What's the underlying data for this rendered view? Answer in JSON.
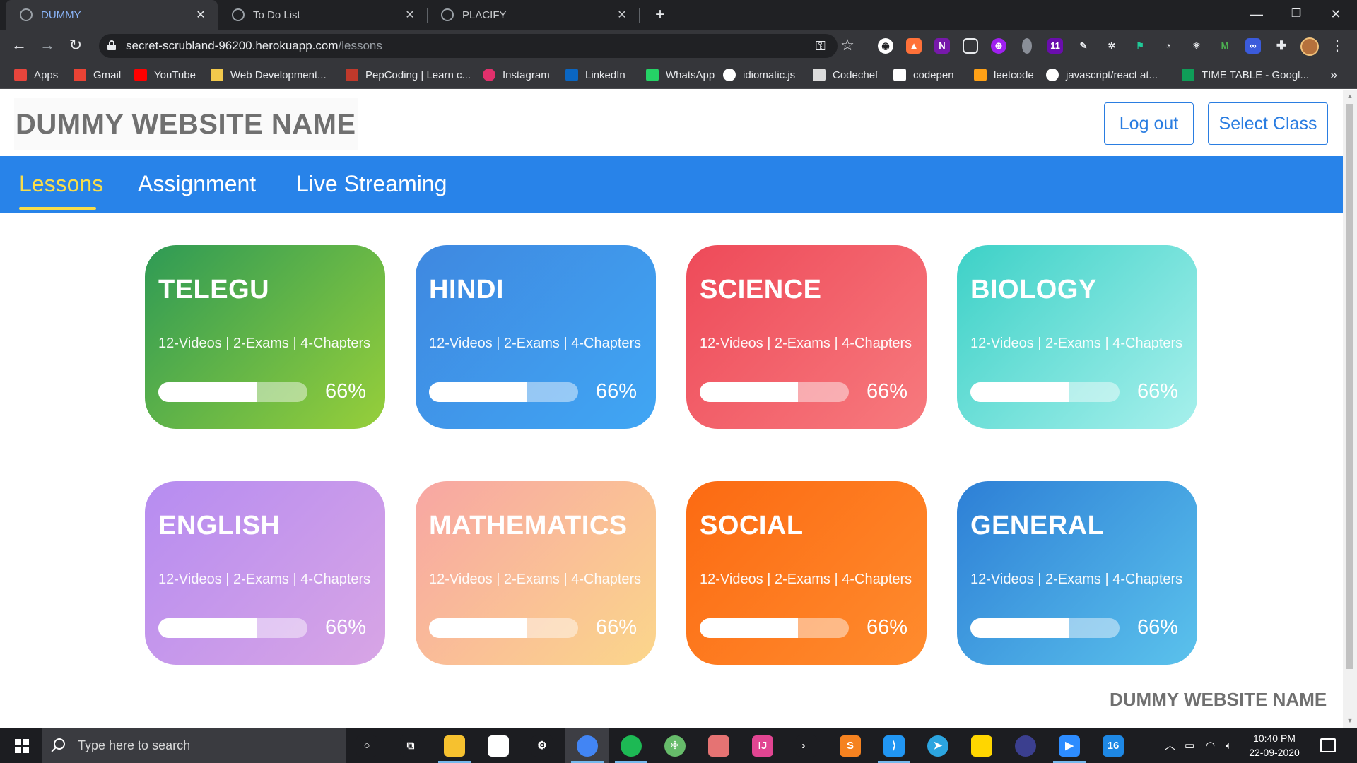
{
  "browser": {
    "tabs": [
      {
        "title": "DUMMY",
        "active": true
      },
      {
        "title": "To Do List",
        "active": false
      },
      {
        "title": "PLACIFY",
        "active": false
      }
    ],
    "new_tab_symbol": "+",
    "address": {
      "domain": "secret-scrubland-96200.herokuapp.com",
      "path": "/lessons"
    },
    "bookmarks": [
      {
        "label": "Apps",
        "icon": "apps-grid-icon",
        "color": "#e8453c"
      },
      {
        "label": "Gmail",
        "icon": "gmail-icon",
        "color": "#ea4335"
      },
      {
        "label": "YouTube",
        "icon": "youtube-icon",
        "color": "#ff0000"
      },
      {
        "label": "Web Development...",
        "icon": "web-dev-icon",
        "color": "#f2c94c"
      },
      {
        "label": "PepCoding | Learn c...",
        "icon": "pepcoding-icon",
        "color": "#c0392b"
      },
      {
        "label": "Instagram",
        "icon": "instagram-icon",
        "color": "#e1306c"
      },
      {
        "label": "LinkedIn",
        "icon": "linkedin-icon",
        "color": "#0a66c2"
      },
      {
        "label": "WhatsApp",
        "icon": "whatsapp-icon",
        "color": "#25d366"
      },
      {
        "label": "idiomatic.js",
        "icon": "github-icon",
        "color": "#ffffff"
      },
      {
        "label": "Codechef",
        "icon": "codechef-icon",
        "color": "#dcdcdc"
      },
      {
        "label": "codepen",
        "icon": "codepen-icon",
        "color": "#ffffff"
      },
      {
        "label": "leetcode",
        "icon": "leetcode-icon",
        "color": "#ffa116"
      },
      {
        "label": "javascript/react at...",
        "icon": "github-icon",
        "color": "#ffffff"
      },
      {
        "label": "TIME TABLE - Googl...",
        "icon": "google-sheets-icon",
        "color": "#0f9d58"
      }
    ],
    "bookmarks_more": "»"
  },
  "site": {
    "brand": "DUMMY WEBSITE NAME",
    "logout_label": "Log out",
    "select_class_label": "Select Class",
    "nav": [
      {
        "label": "Lessons",
        "active": true
      },
      {
        "label": "Assignment",
        "active": false
      },
      {
        "label": "Live Streaming",
        "active": false
      }
    ],
    "footer_brand": "DUMMY WEBSITE NAME"
  },
  "courses": [
    {
      "name": "TELEGU",
      "meta": "12-Videos | 2-Exams | 4-Chapters",
      "progress_label": "66%",
      "progress": 0.66,
      "gradient": [
        "#2e9a55",
        "#97cf3a"
      ]
    },
    {
      "name": "HINDI",
      "meta": "12-Videos | 2-Exams | 4-Chapters",
      "progress_label": "66%",
      "progress": 0.66,
      "gradient": [
        "#3f88e0",
        "#40a6f4"
      ]
    },
    {
      "name": "SCIENCE",
      "meta": "12-Videos | 2-Exams | 4-Chapters",
      "progress_label": "66%",
      "progress": 0.66,
      "gradient": [
        "#ee4a59",
        "#f77a7e"
      ]
    },
    {
      "name": "BIOLOGY",
      "meta": "12-Videos | 2-Exams | 4-Chapters",
      "progress_label": "66%",
      "progress": 0.66,
      "gradient": [
        "#3dd1c7",
        "#a7f0ec"
      ]
    },
    {
      "name": "ENGLISH",
      "meta": "12-Videos | 2-Exams | 4-Chapters",
      "progress_label": "66%",
      "progress": 0.66,
      "gradient": [
        "#b68cf1",
        "#d8a5e5"
      ]
    },
    {
      "name": "MATHEMATICS",
      "meta": "12-Videos | 2-Exams | 4-Chapters",
      "progress_label": "66%",
      "progress": 0.66,
      "gradient": [
        "#f8a6a3",
        "#fbd68b"
      ]
    },
    {
      "name": "SOCIAL",
      "meta": "12-Videos | 2-Exams | 4-Chapters",
      "progress_label": "66%",
      "progress": 0.66,
      "gradient": [
        "#fc6a12",
        "#ff8c2e"
      ]
    },
    {
      "name": "GENERAL",
      "meta": "12-Videos | 2-Exams | 4-Chapters",
      "progress_label": "66%",
      "progress": 0.66,
      "gradient": [
        "#2d7fd6",
        "#5bc2ec"
      ]
    }
  ],
  "taskbar": {
    "search_placeholder": "Type here to search",
    "apps": [
      {
        "icon": "cortana-icon",
        "color": "#1c1d21"
      },
      {
        "icon": "task-view-icon",
        "color": "#1c1d21"
      },
      {
        "icon": "file-explorer-icon",
        "color": "#f6c12f"
      },
      {
        "icon": "store-icon",
        "color": "#ffffff"
      },
      {
        "icon": "settings-icon",
        "color": "#1c1d21"
      },
      {
        "icon": "chrome-icon",
        "color": "#4285f4"
      },
      {
        "icon": "spotify-icon",
        "color": "#1db954"
      },
      {
        "icon": "atom-icon",
        "color": "#66bb6a"
      },
      {
        "icon": "paint-icon",
        "color": "#e57373"
      },
      {
        "icon": "intellij-icon",
        "color": "#e14592"
      },
      {
        "icon": "terminal-icon",
        "color": "#1c1d21"
      },
      {
        "icon": "sublime-icon",
        "color": "#f58220"
      },
      {
        "icon": "vscode-icon",
        "color": "#2196f3"
      },
      {
        "icon": "telegram-icon",
        "color": "#2ca5e0"
      },
      {
        "icon": "sticky-notes-icon",
        "color": "#ffd600"
      },
      {
        "icon": "eclipse-icon",
        "color": "#3b3f8f"
      },
      {
        "icon": "zoom-icon",
        "color": "#2d8cff"
      },
      {
        "icon": "sixteen-app-icon",
        "color": "#1e88e5"
      }
    ],
    "app_badge_text": "16",
    "time": "10:40 PM",
    "date": "22-09-2020"
  }
}
